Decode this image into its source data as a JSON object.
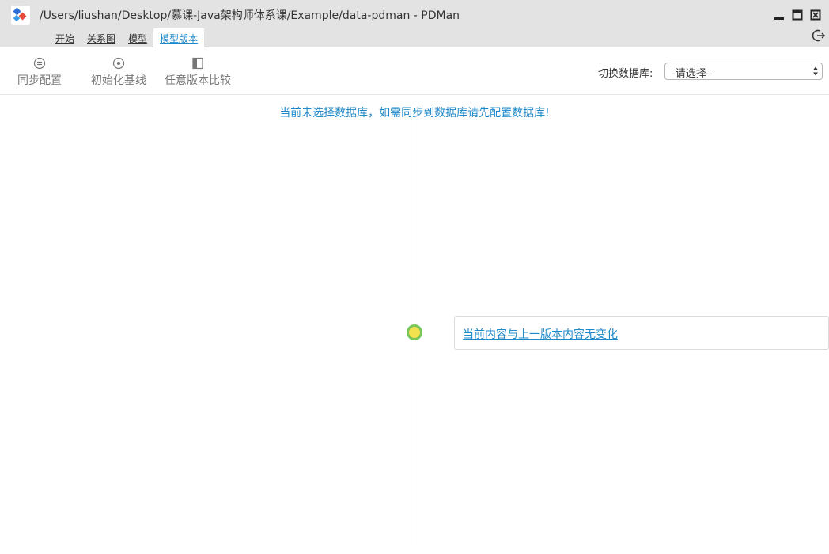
{
  "window": {
    "title": "/Users/liushan/Desktop/慕课-Java架构师体系课/Example/data-pdman - PDMan"
  },
  "menu": {
    "items": [
      {
        "label": "开始"
      },
      {
        "label": "关系图"
      },
      {
        "label": "模型"
      },
      {
        "label": "模型版本"
      }
    ],
    "active_index": 3
  },
  "toolbar": {
    "sync_config": {
      "label": "同步配置",
      "icon": "sync-config-icon"
    },
    "init_baseline": {
      "label": "初始化基线",
      "icon": "target-icon"
    },
    "compare_versions": {
      "label": "任意版本比较",
      "icon": "panel-compare-icon"
    },
    "db_switch_label": "切换数据库:",
    "db_select_value": "-请选择-"
  },
  "content": {
    "notice": "当前未选择数据库，如需同步到数据库请先配置数据库!",
    "version_item_text": "当前内容与上一版本内容无变化"
  },
  "colors": {
    "accent": "#1e88c8",
    "titlebar_bg": "#e3e3e3",
    "dot_fill": "#f2e250",
    "dot_border": "#7cc35a"
  }
}
